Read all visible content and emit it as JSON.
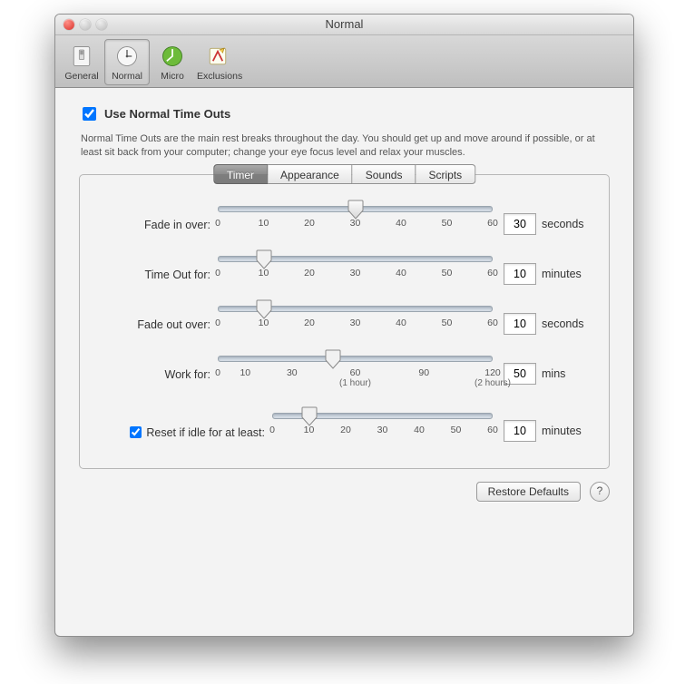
{
  "window": {
    "title": "Normal"
  },
  "toolbar": {
    "items": [
      {
        "label": "General",
        "selected": false
      },
      {
        "label": "Normal",
        "selected": true
      },
      {
        "label": "Micro",
        "selected": false
      },
      {
        "label": "Exclusions",
        "selected": false
      }
    ]
  },
  "checkbox": {
    "label": "Use Normal Time Outs",
    "checked": true
  },
  "description": "Normal Time Outs are the main rest breaks throughout the day.  You should get up and move around if possible, or at least sit back from your computer; change your eye focus level and relax your muscles.",
  "tabs": {
    "items": [
      {
        "label": "Timer",
        "active": true
      },
      {
        "label": "Appearance",
        "active": false
      },
      {
        "label": "Sounds",
        "active": false
      },
      {
        "label": "Scripts",
        "active": false
      }
    ]
  },
  "sliders": {
    "fade_in": {
      "label": "Fade in over:",
      "value": "30",
      "unit": "seconds",
      "min": 0,
      "max": 60,
      "ticks": [
        "0",
        "10",
        "20",
        "30",
        "40",
        "50",
        "60"
      ]
    },
    "time_out": {
      "label": "Time Out for:",
      "value": "10",
      "unit": "minutes",
      "min": 0,
      "max": 60,
      "ticks": [
        "0",
        "10",
        "20",
        "30",
        "40",
        "50",
        "60"
      ]
    },
    "fade_out": {
      "label": "Fade out over:",
      "value": "10",
      "unit": "seconds",
      "min": 0,
      "max": 60,
      "ticks": [
        "0",
        "10",
        "20",
        "30",
        "40",
        "50",
        "60"
      ]
    },
    "work_for": {
      "label": "Work for:",
      "value": "50",
      "unit": "mins",
      "min": 0,
      "max": 120,
      "ticks": [
        "0",
        "10",
        "30",
        "60",
        "90",
        "120"
      ],
      "subticks": {
        "60": "(1 hour)",
        "120": "(2 hours)"
      }
    },
    "idle": {
      "label": "Reset if idle for at least:",
      "checked": true,
      "value": "10",
      "unit": "minutes",
      "min": 0,
      "max": 60,
      "ticks": [
        "0",
        "10",
        "20",
        "30",
        "40",
        "50",
        "60"
      ]
    }
  },
  "footer": {
    "restore": "Restore Defaults",
    "help": "?"
  }
}
